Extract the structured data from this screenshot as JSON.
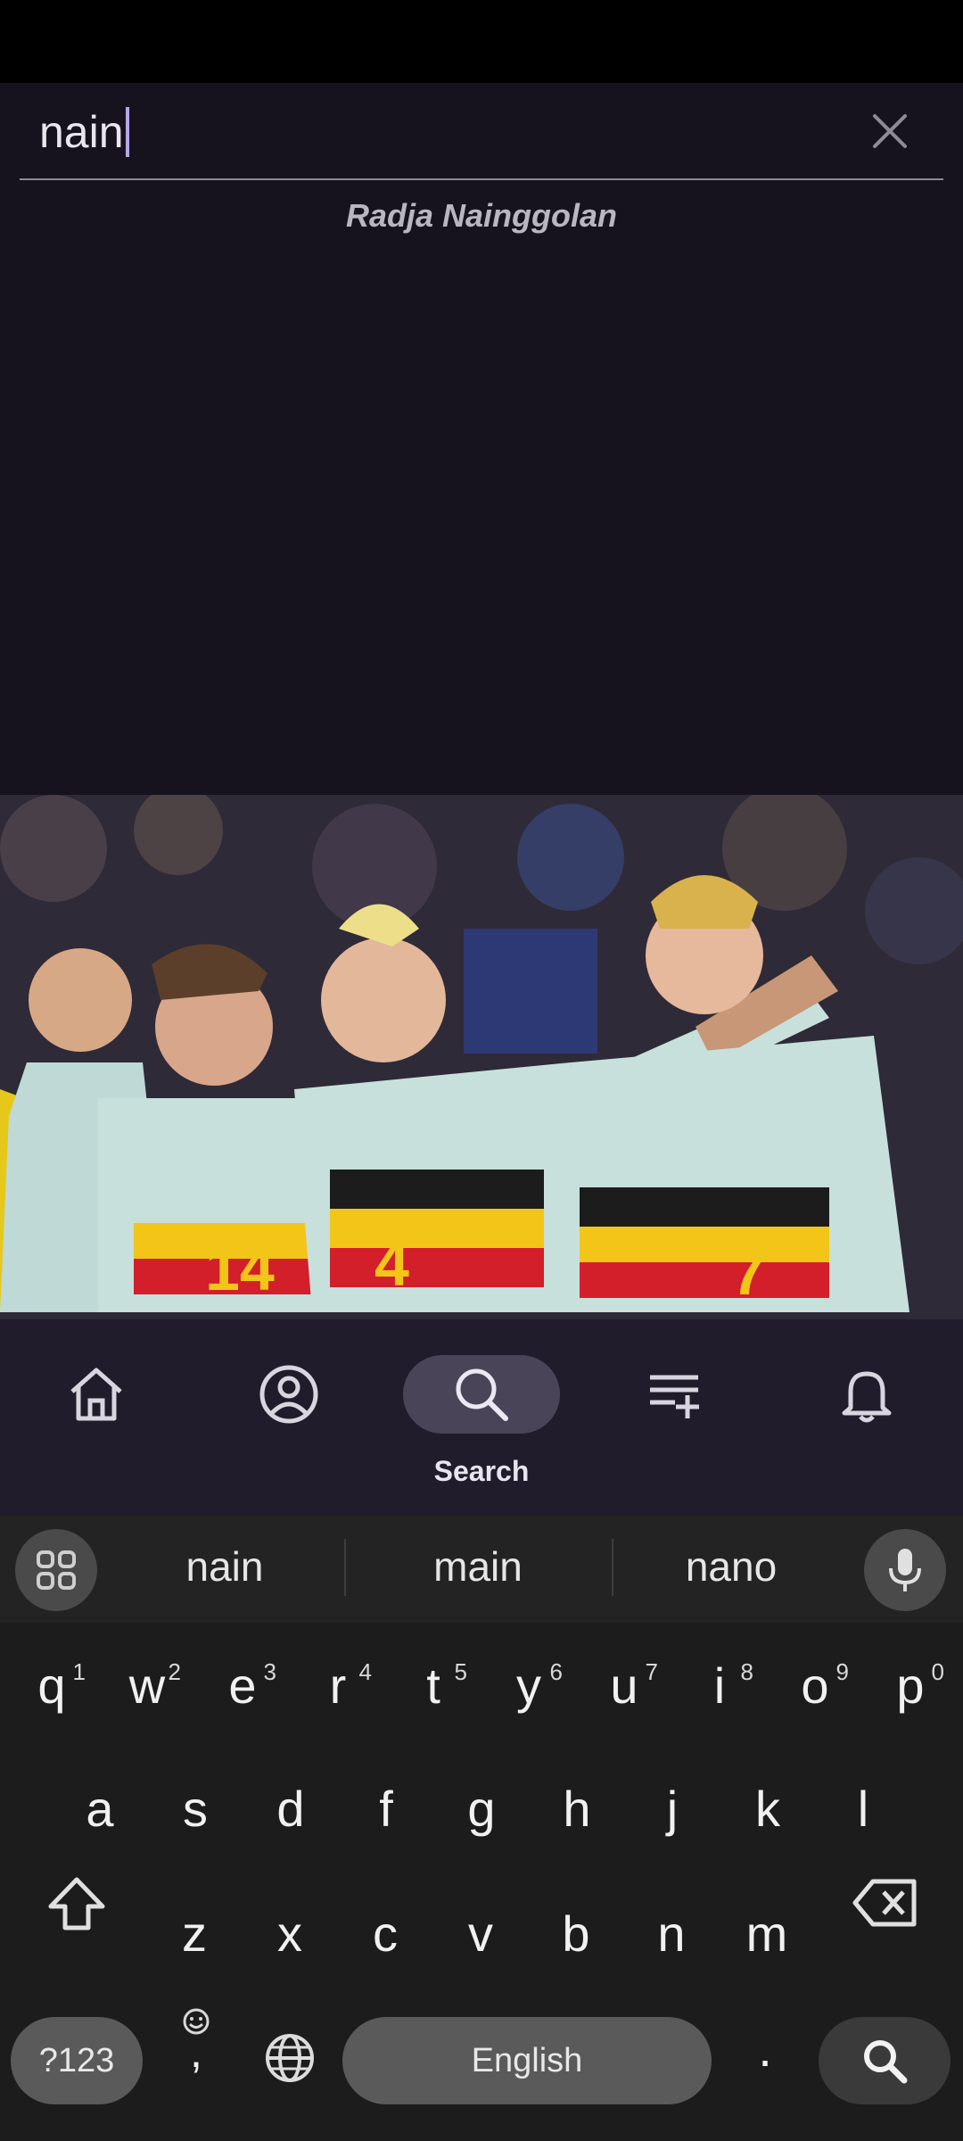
{
  "search": {
    "value": "nain",
    "suggestion": "Radja Nainggolan"
  },
  "nav": {
    "items": [
      {
        "icon": "home-icon",
        "label": ""
      },
      {
        "icon": "profile-icon",
        "label": ""
      },
      {
        "icon": "search-icon",
        "label": "Search"
      },
      {
        "icon": "playlist-add-icon",
        "label": ""
      },
      {
        "icon": "bell-icon",
        "label": ""
      }
    ]
  },
  "keyboard": {
    "suggestions": [
      "nain",
      "main",
      "nano"
    ],
    "row1": [
      "q",
      "w",
      "e",
      "r",
      "t",
      "y",
      "u",
      "i",
      "o",
      "p"
    ],
    "row1_hints": [
      "1",
      "2",
      "3",
      "4",
      "5",
      "6",
      "7",
      "8",
      "9",
      "0"
    ],
    "row2": [
      "a",
      "s",
      "d",
      "f",
      "g",
      "h",
      "j",
      "k",
      "l"
    ],
    "row3": [
      "z",
      "x",
      "c",
      "v",
      "b",
      "n",
      "m"
    ],
    "symbols_key": "?123",
    "comma_key": ",",
    "space_label": "English",
    "period_key": "."
  },
  "colors": {
    "background": "#16131f",
    "nav_background": "#201c2b",
    "nav_active_pill": "#4a4459",
    "keyboard_background": "#1c1c1c"
  }
}
